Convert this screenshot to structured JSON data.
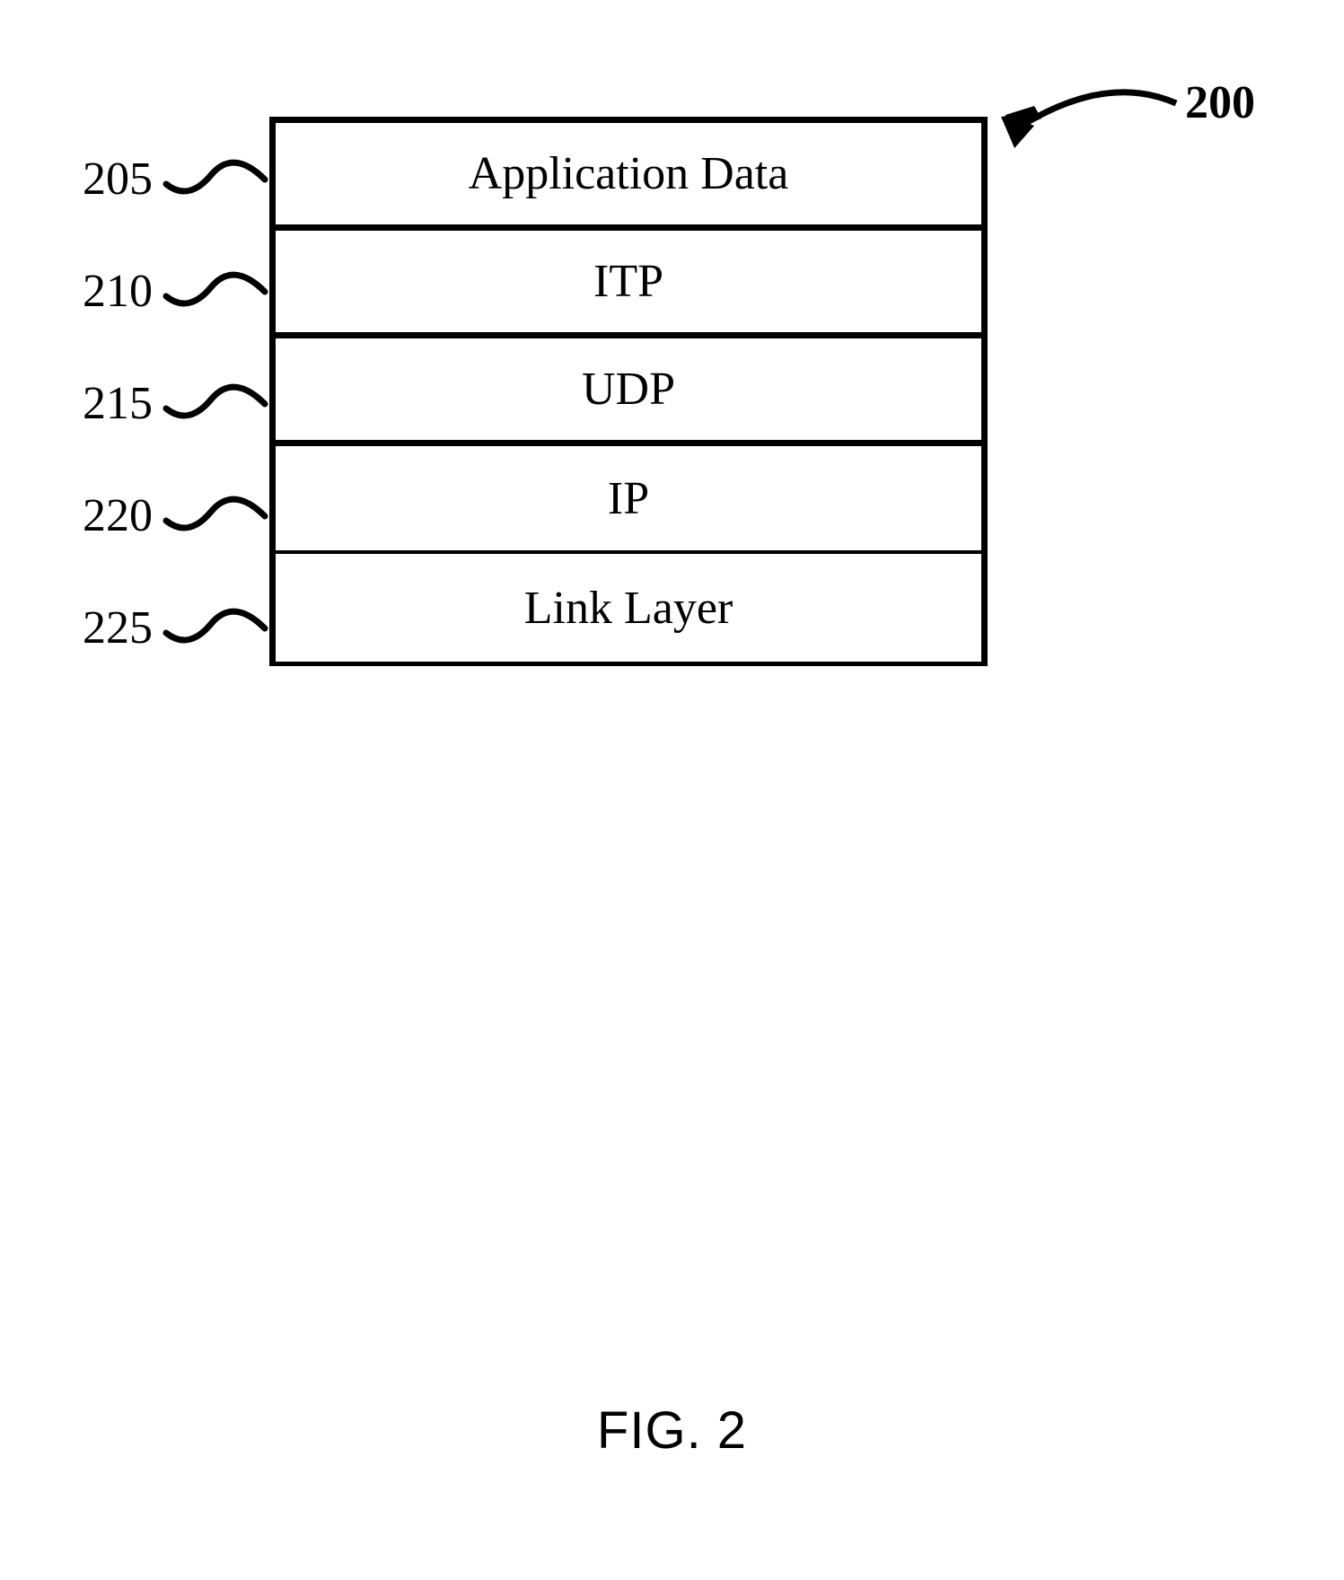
{
  "figure": {
    "caption": "FIG. 2",
    "main_ref": "200",
    "layers": [
      {
        "ref": "205",
        "label": "Application Data"
      },
      {
        "ref": "210",
        "label": "ITP"
      },
      {
        "ref": "215",
        "label": "UDP"
      },
      {
        "ref": "220",
        "label": "IP"
      },
      {
        "ref": "225",
        "label": "Link Layer"
      }
    ]
  }
}
